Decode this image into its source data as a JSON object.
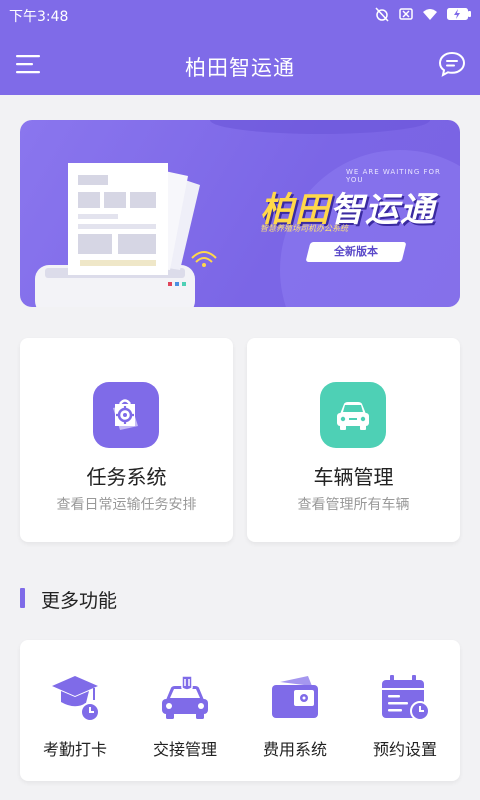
{
  "status_bar": {
    "time": "下午3:48",
    "icons": [
      "alarm-off-icon",
      "sim-off-icon",
      "wifi-icon",
      "battery-charging-icon"
    ]
  },
  "header": {
    "title": "柏田智运通",
    "menu_icon": "menu-icon",
    "chat_icon": "message-icon"
  },
  "banner": {
    "title_part1": "柏田",
    "title_part2": "智运通",
    "english_tagline": "WE ARE WAITING FOR YOU",
    "subtitle": "智慧养殖场司机办公系统",
    "badge": "全新版本"
  },
  "main_cards": [
    {
      "label": "任务系统",
      "desc": "查看日常运输任务安排",
      "icon": "task-icon",
      "color": "#7f6be8"
    },
    {
      "label": "车辆管理",
      "desc": "查看管理所有车辆",
      "icon": "car-icon",
      "color": "#4ed0b5"
    }
  ],
  "more_section": {
    "title": "更多功能",
    "items": [
      {
        "label": "考勤打卡",
        "icon": "attendance-icon"
      },
      {
        "label": "交接管理",
        "icon": "handover-icon"
      },
      {
        "label": "费用系统",
        "icon": "wallet-icon"
      },
      {
        "label": "预约设置",
        "icon": "calendar-icon"
      }
    ]
  },
  "colors": {
    "primary": "#7f6be8",
    "teal": "#4ed0b5",
    "background": "#f2f2f4"
  }
}
